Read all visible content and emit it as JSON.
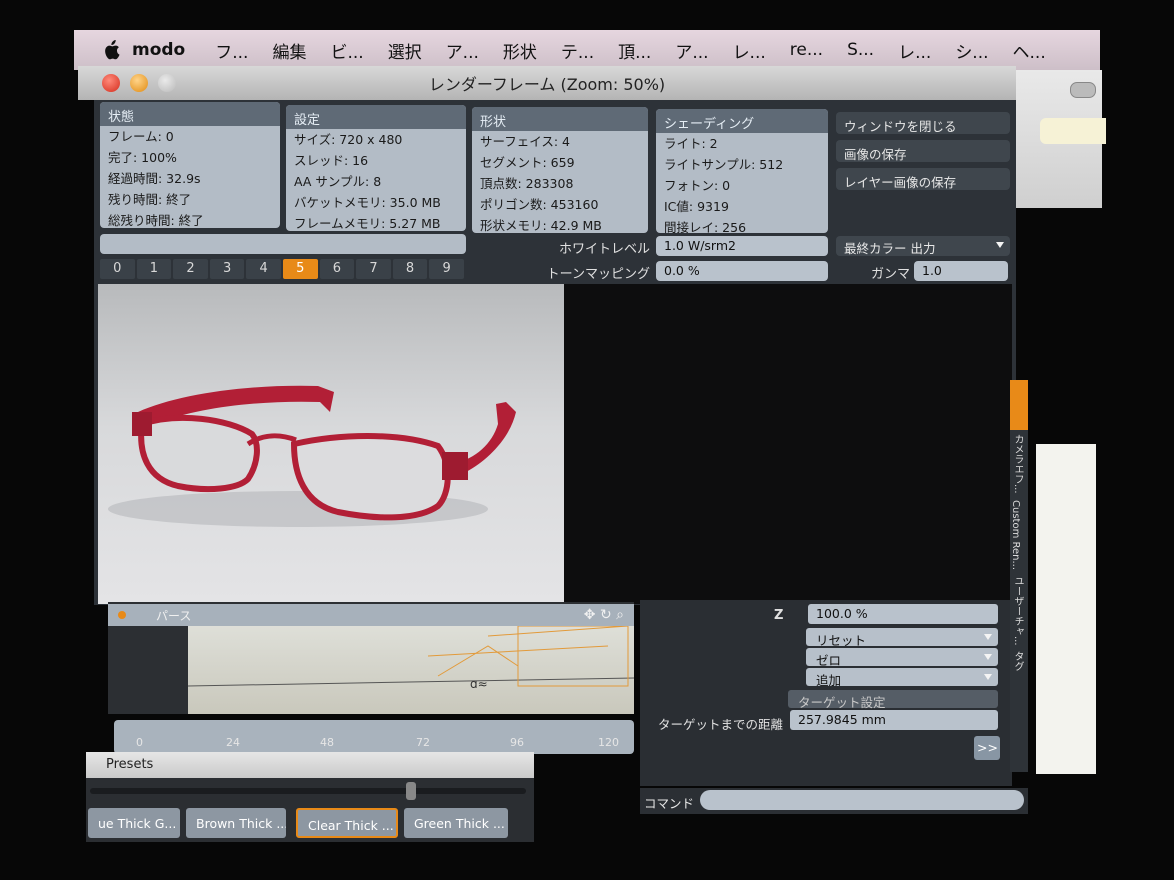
{
  "menubar": {
    "app_name": "modo",
    "items": [
      "フ...",
      "編集",
      "ビ...",
      "選択",
      "ア...",
      "形状",
      "テ...",
      "頂...",
      "ア...",
      "レ...",
      "re...",
      "S...",
      "レ...",
      "シ...",
      "ヘ..."
    ]
  },
  "window": {
    "title": "レンダーフレーム (Zoom: 50%)"
  },
  "status_panel": {
    "header": "状態",
    "rows": [
      "フレーム: 0",
      "完了: 100%",
      "経過時間: 32.9s",
      "残り時間: 終了",
      "総残り時間: 終了"
    ]
  },
  "settings_panel": {
    "header": "設定",
    "rows": [
      "サイズ: 720 x 480",
      "スレッド: 16",
      "AA サンプル: 8",
      "バケットメモリ: 35.0 MB",
      "フレームメモリ: 5.27 MB"
    ]
  },
  "geometry_panel": {
    "header": "形状",
    "rows": [
      "サーフェイス: 4",
      "セグメント: 659",
      "頂点数: 283308",
      "ポリゴン数: 453160",
      "形状メモリ: 42.9 MB"
    ]
  },
  "shading_panel": {
    "header": "シェーディング",
    "rows": [
      "ライト: 2",
      "ライトサンプル: 512",
      "フォトン: 0",
      "IC値: 9319",
      "間接レイ: 256"
    ]
  },
  "actions": {
    "close_window": "ウィンドウを閉じる",
    "save_image": "画像の保存",
    "save_layer_image": "レイヤー画像の保存"
  },
  "controls": {
    "white_level_label": "ホワイトレベル",
    "white_level_value": "1.0 W/srm2",
    "tone_mapping_label": "トーンマッピング",
    "tone_mapping_value": "0.0 %",
    "output_select": "最終カラー 出力",
    "gamma_label": "ガンマ",
    "gamma_value": "1.0"
  },
  "frame_tabs": [
    "0",
    "1",
    "2",
    "3",
    "4",
    "5",
    "6",
    "7",
    "8",
    "9"
  ],
  "active_frame": 5,
  "viewport": {
    "tab_perspective": "パース",
    "timeline_ticks": [
      "0",
      "24",
      "48",
      "72",
      "96",
      "120"
    ]
  },
  "properties": {
    "z_label": "Z",
    "z_value": "100.0 %",
    "reset": "リセット",
    "zero": "ゼロ",
    "add": "追加",
    "target_settings": "ターゲット設定",
    "target_distance_label": "ターゲットまでの距離",
    "target_distance_value": "257.9845 mm",
    "more_button": ">>"
  },
  "command": {
    "label": "コマンド",
    "value": ""
  },
  "side_tabs": [
    "カメラエフ...",
    "Custom Ren...",
    "ユーザーチャ...",
    "タグ"
  ],
  "presets": {
    "header": "Presets",
    "items": [
      "ue Thick G...",
      "Brown Thick ...",
      "Clear Thick ...",
      "Green Thick ..."
    ]
  },
  "colors": {
    "accent": "#e88a18",
    "panel": "#b3bcc6",
    "panel_header": "#5f6a76",
    "frame_color": "#b8243a"
  }
}
